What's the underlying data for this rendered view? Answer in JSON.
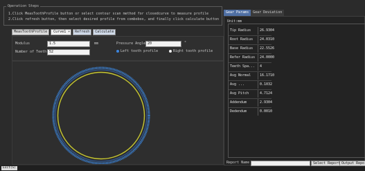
{
  "left_panel": {
    "instructions": {
      "title": "Operation Steps",
      "line1": "1.Click MeasToothProfile button or select contour scan method for closedcurve to measure profile",
      "line2": "2.Click refresh button, then select desired profile from combobox, and finally click calculate button"
    },
    "toolbar": {
      "measure_label": "MeasToothProfile",
      "profile_value": "Curve1",
      "refresh_label": "Refresh",
      "calculate_label": "Calculate"
    },
    "params": {
      "module_label": "Modulus",
      "module_value": "1.5",
      "module_unit": "mm",
      "teeth_label": "Number of Teeth",
      "teeth_value": "52",
      "pressure_label": "Pressure Angle",
      "pressure_value": "20",
      "pressure_unit": "°",
      "radio_left": "Left tooth profile",
      "radio_right": "Right tooth profile",
      "selected_side": "left"
    },
    "status_button": "Exit(S)"
  },
  "right_panel": {
    "tabs": [
      {
        "label": "Gear Params"
      },
      {
        "label": "Gear Deviation"
      }
    ],
    "unit_title": "Unit:mm",
    "rows": [
      {
        "label": "Tip Radius",
        "value": "26.9304"
      },
      {
        "label": "Root Radius",
        "value": "24.0310"
      },
      {
        "label": "Base Radius",
        "value": "22.5526"
      },
      {
        "label": "Refer Radius",
        "value": "24.0000"
      },
      {
        "label": "Teeth Spa...",
        "value": "4"
      },
      {
        "label": "Avg Normal",
        "value": "16.1710"
      },
      {
        "label": "Avg ...",
        "value": "0.1032"
      },
      {
        "label": "Avg Pitch",
        "value": "4.7124"
      },
      {
        "label": "Addendum",
        "value": "2.9304"
      },
      {
        "label": "Dedendum",
        "value": "0.0010"
      }
    ],
    "report_label": "Report Name",
    "report_value": "",
    "select_report_label": "Select Report",
    "output_report_label": "Output Report"
  },
  "colors": {
    "background": "#2b2b2b",
    "tab_active": "#4f6fa4",
    "ring_outer": "#3a7fd0",
    "ring_inner": "#c8c830",
    "radio_selected": "#3d86e0"
  }
}
